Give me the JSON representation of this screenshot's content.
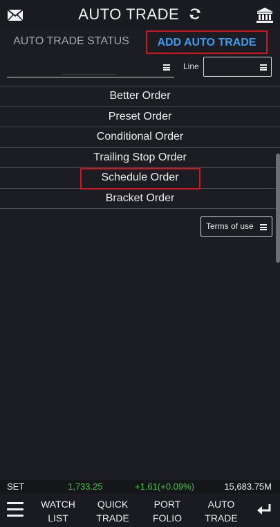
{
  "header": {
    "title": "AUTO TRADE",
    "icons": {
      "left": "mail-icon",
      "refresh": "refresh-icon",
      "right": "bank-icon"
    }
  },
  "tabs": [
    {
      "label": "AUTO TRADE STATUS",
      "active": false
    },
    {
      "label": "ADD AUTO TRADE",
      "active": true
    }
  ],
  "filters": {
    "line_label": "Line",
    "select1_value": "",
    "select2_value": ""
  },
  "order_types": [
    {
      "label": "Better Order"
    },
    {
      "label": "Preset Order"
    },
    {
      "label": "Conditional Order"
    },
    {
      "label": "Trailing Stop Order"
    },
    {
      "label": "Schedule Order",
      "highlighted": true
    },
    {
      "label": "Bracket Order"
    }
  ],
  "terms": {
    "label": "Terms of use"
  },
  "ticker": {
    "name": "SET",
    "index": "1,733.25",
    "change": "+1.61(+0.09%)",
    "volume": "15,683.75M"
  },
  "bottom_nav": [
    {
      "line1": "WATCH",
      "line2": "LIST"
    },
    {
      "line1": "QUICK",
      "line2": "TRADE"
    },
    {
      "line1": "PORT",
      "line2": "FOLIO"
    },
    {
      "line1": "AUTO",
      "line2": "TRADE"
    }
  ],
  "colors": {
    "background": "#1c1d22",
    "accent": "#3b9cf2",
    "highlight": "#d4141c",
    "positive": "#3cc43c"
  }
}
